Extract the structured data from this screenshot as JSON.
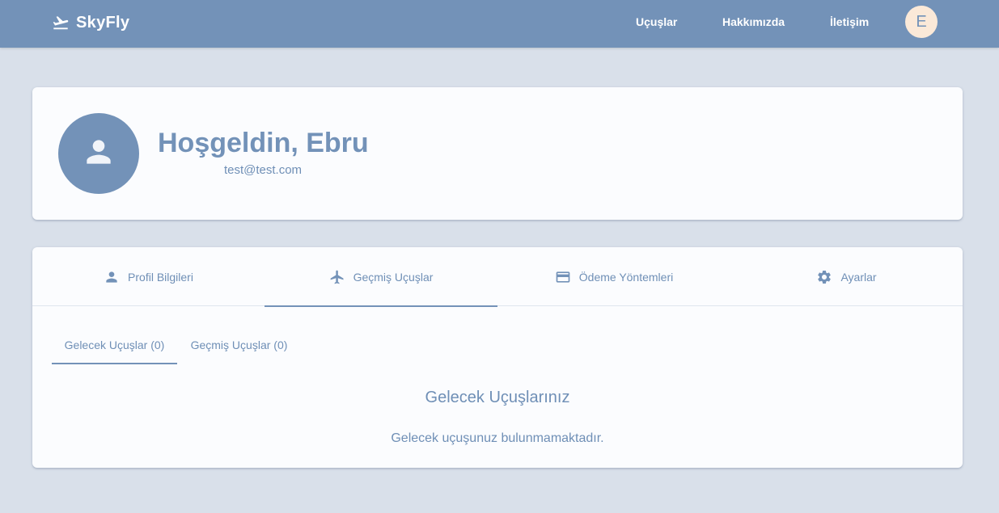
{
  "navbar": {
    "brand": "SkyFly",
    "brand_icon": "flight-takeoff-icon",
    "links": [
      "Uçuşlar",
      "Hakkımızda",
      "İletişim"
    ],
    "avatar_initial": "E",
    "background": "#7392b8"
  },
  "profile": {
    "welcome": "Hoşgeldin, Ebru",
    "email": "test@test.com",
    "avatar_icon": "person-icon"
  },
  "main_tabs": [
    {
      "label": "Profil Bilgileri",
      "icon": "person-icon",
      "active": false
    },
    {
      "label": "Geçmiş Uçuşlar",
      "icon": "airplane-icon",
      "active": true
    },
    {
      "label": "Ödeme Yöntemleri",
      "icon": "credit-card-icon",
      "active": false
    },
    {
      "label": "Ayarlar",
      "icon": "gear-icon",
      "active": false
    }
  ],
  "sub_tabs": [
    {
      "label": "Gelecek Uçuşlar (0)",
      "active": true
    },
    {
      "label": "Geçmiş Uçuşlar (0)",
      "active": false
    }
  ],
  "content": {
    "title": "Gelecek Uçuşlarınız",
    "empty_message": "Gelecek uçuşunuz bulunmamaktadır."
  },
  "colors": {
    "accent": "#7392b8",
    "page_background": "#d9e0ea",
    "avatar_background": "#fbe9d8"
  }
}
